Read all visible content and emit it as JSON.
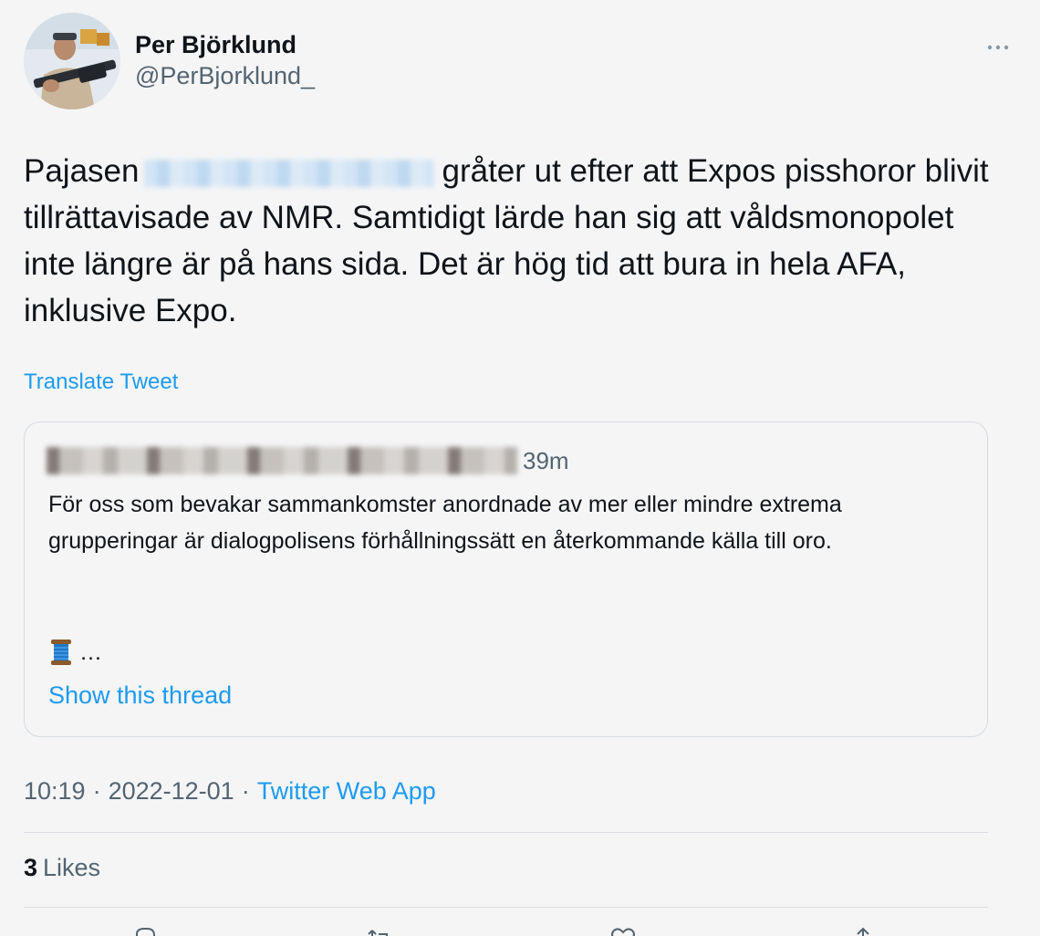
{
  "author": {
    "display_name": "Per Björklund",
    "handle": "@PerBjorklund_",
    "avatar_icon": "profile-photo"
  },
  "tweet": {
    "text_before": "Pajasen",
    "text_after": "gråter ut efter att Expos pisshoror blivit tillrättavisade av NMR. Samtidigt lärde han sig att våldsmonopolet inte längre är på hans sida. Det är hög tid att bura in hela AFA, inklusive Expo.",
    "translate_label": "Translate Tweet"
  },
  "quoted_tweet": {
    "time": "39m",
    "text": "För oss som bevakar sammankomster anordnade av mer eller mindre extrema grupperingar är dialogpolisens förhållningssätt en återkommande källa till oro.",
    "trailing": "…",
    "emoji_icon": "spool-of-thread-icon",
    "show_thread_label": "Show this thread"
  },
  "meta": {
    "time": "10:19",
    "separator": "·",
    "date": "2022-12-01",
    "source": "Twitter Web App"
  },
  "stats": {
    "likes_count": "3",
    "likes_label": "Likes"
  },
  "colors": {
    "link": "#1d9bf0",
    "secondary_text": "#536471",
    "background": "#f5f5f6"
  }
}
